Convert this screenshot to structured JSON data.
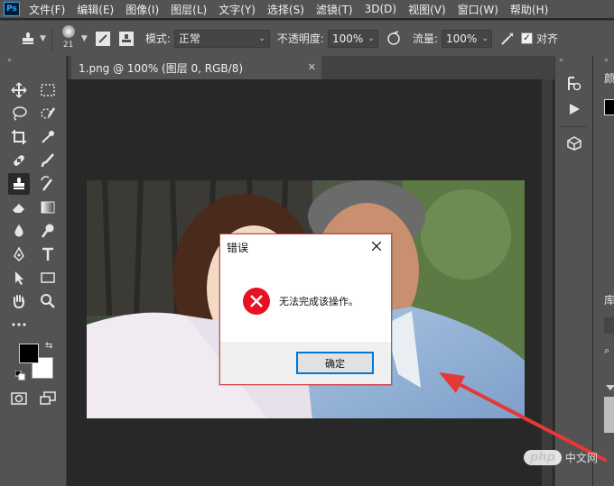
{
  "app": {
    "logo_text": "Ps"
  },
  "menu": {
    "items": [
      "文件(F)",
      "编辑(E)",
      "图像(I)",
      "图层(L)",
      "文字(Y)",
      "选择(S)",
      "滤镜(T)",
      "3D(D)",
      "视图(V)",
      "窗口(W)",
      "帮助(H)"
    ]
  },
  "options": {
    "brush_size": "21",
    "mode_label": "模式:",
    "mode_value": "正常",
    "opacity_label": "不透明度:",
    "opacity_value": "100%",
    "flow_label": "流量:",
    "flow_value": "100%",
    "align_label": "对齐",
    "align_checked": true
  },
  "document": {
    "tab_title": "1.png @ 100% (图层 0, RGB/8)",
    "tab_close": "✕"
  },
  "right_panel": {
    "color_tab_partial": "颜",
    "library_tab_partial": "库"
  },
  "dialog": {
    "title": "错误",
    "message": "无法完成该操作。",
    "ok_label": "确定"
  },
  "colors": {
    "ps_bg": "#535353",
    "canvas_bg": "#282828",
    "error_red": "#e81123",
    "focus_blue": "#0078d7",
    "annotation_arrow": "#e53935",
    "foreground_swatch": "#000000",
    "background_swatch": "#ffffff"
  },
  "watermark": {
    "badge": "php",
    "text": "中文网"
  }
}
